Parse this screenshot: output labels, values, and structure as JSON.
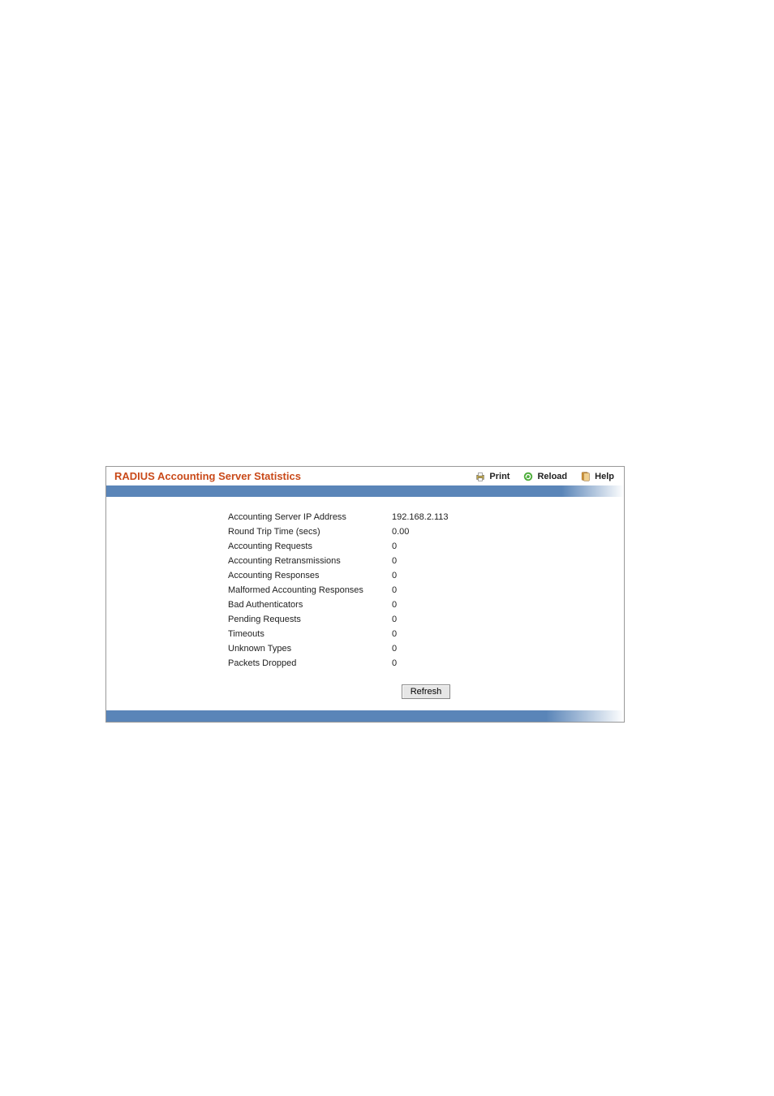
{
  "header": {
    "title": "RADIUS Accounting Server Statistics",
    "actions": {
      "print": "Print",
      "reload": "Reload",
      "help": "Help"
    }
  },
  "stats": [
    {
      "label": "Accounting Server IP Address",
      "value": "192.168.2.113"
    },
    {
      "label": "Round Trip Time (secs)",
      "value": "0.00"
    },
    {
      "label": "Accounting Requests",
      "value": "0"
    },
    {
      "label": "Accounting Retransmissions",
      "value": "0"
    },
    {
      "label": "Accounting Responses",
      "value": "0"
    },
    {
      "label": "Malformed Accounting Responses",
      "value": "0"
    },
    {
      "label": "Bad Authenticators",
      "value": "0"
    },
    {
      "label": "Pending Requests",
      "value": "0"
    },
    {
      "label": "Timeouts",
      "value": "0"
    },
    {
      "label": "Unknown Types",
      "value": "0"
    },
    {
      "label": "Packets Dropped",
      "value": "0"
    }
  ],
  "buttons": {
    "refresh": "Refresh"
  }
}
